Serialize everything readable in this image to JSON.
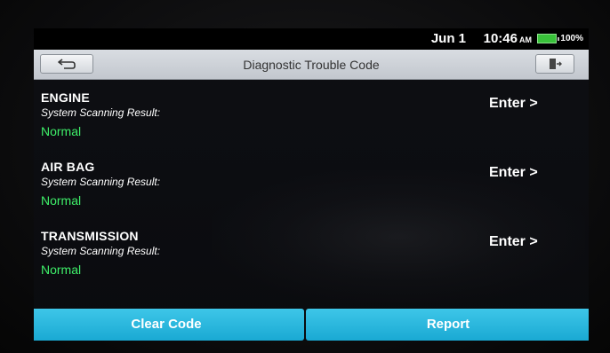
{
  "status_bar": {
    "date": "Jun 1",
    "time": "10:46",
    "ampm": "AM",
    "battery_pct": "100%",
    "battery_color": "#39c23a"
  },
  "header": {
    "title": "Diagnostic Trouble Code",
    "back_icon": "back-arrow-icon",
    "exit_icon": "exit-icon"
  },
  "systems": [
    {
      "name": "ENGINE",
      "label": "System Scanning Result:",
      "status": "Normal",
      "action": "Enter >"
    },
    {
      "name": "AIR BAG",
      "label": "System Scanning Result:",
      "status": "Normal",
      "action": "Enter >"
    },
    {
      "name": "TRANSMISSION",
      "label": "System Scanning Result:",
      "status": "Normal",
      "action": "Enter >"
    }
  ],
  "footer": {
    "clear_label": "Clear Code",
    "report_label": "Report",
    "button_color": "#1aa9d3"
  },
  "colors": {
    "status_normal": "#3ff06a"
  }
}
